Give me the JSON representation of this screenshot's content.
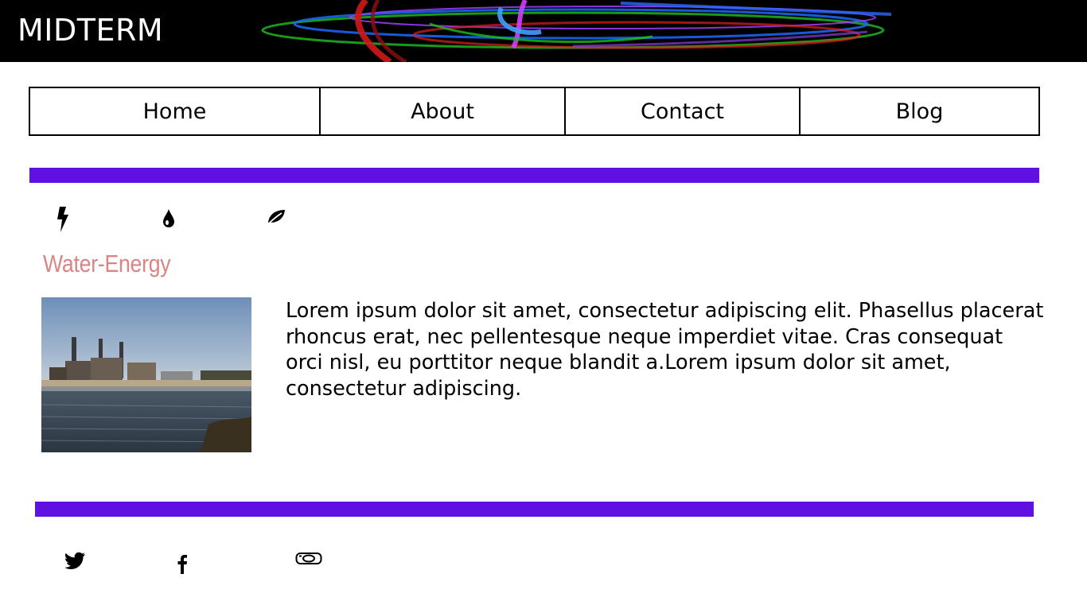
{
  "header": {
    "title": "MIDTERM"
  },
  "nav": {
    "items": [
      {
        "label": "Home"
      },
      {
        "label": "About"
      },
      {
        "label": "Contact"
      },
      {
        "label": "Blog"
      }
    ]
  },
  "categories": {
    "icons": [
      "lightning-icon",
      "water-drop-icon",
      "leaf-icon"
    ]
  },
  "section": {
    "title": "Water-Energy",
    "body": "Lorem ipsum dolor sit amet, consectetur adipiscing elit. Phasellus placerat rhoncus erat, nec pellentesque neque imperdiet vitae. Cras consequat orci nisl, eu porttitor neque blandit a.Lorem ipsum dolor sit amet, consectetur adipiscing."
  },
  "footer": {
    "social_icons": [
      "twitter-icon",
      "facebook-icon",
      "instagram-icon"
    ]
  },
  "colors": {
    "accent_bar": "#6010e0",
    "section_title": "#d98585",
    "header_bg": "#000000"
  }
}
